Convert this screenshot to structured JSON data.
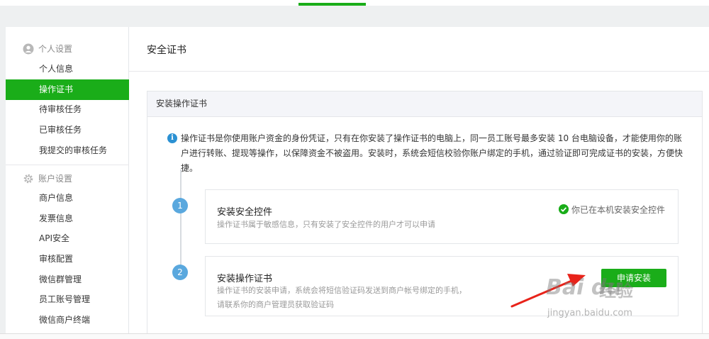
{
  "sidebar": {
    "personal_group": "个人设置",
    "personal_items": [
      "个人信息",
      "操作证书",
      "待审核任务",
      "已审核任务",
      "我提交的审核任务"
    ],
    "account_group": "账户设置",
    "account_items": [
      "商户信息",
      "发票信息",
      "API安全",
      "审核配置",
      "微信群管理",
      "员工账号管理",
      "微信商户终端"
    ],
    "active_item": "操作证书"
  },
  "main": {
    "page_title": "安全证书",
    "panel_title": "安装操作证书",
    "info_icon": "i",
    "info_text": "操作证书是你使用账户资金的身份凭证，只有在你安装了操作证书的电脑上，同一员工账号最多安装 10 台电脑设备，才能使用你的账户进行转账、提现等操作，以保障资金不被盗用。安装时，系统会短信校验你账户绑定的手机，通过验证即可完成证书的安装，方便快捷。",
    "steps": [
      {
        "number": "1",
        "title": "安装安全控件",
        "desc": "操作证书属于敏感信息，只有安装了安全控件的用户才可以申请",
        "status": "你已在本机安装安全控件"
      },
      {
        "number": "2",
        "title": "安装操作证书",
        "desc_line1": "操作证书的安装申请，系统会将短信验证码发送到商户帐号绑定的手机，",
        "desc_line2": "请联系你的商户管理员获取验证码",
        "button": "申请安装"
      }
    ]
  },
  "annotation": {
    "arrow_color": "#e8231a"
  },
  "watermark": {
    "brand": "Bai du",
    "text": "经验",
    "url": "jingyan.baidu.com"
  },
  "colors": {
    "accent": "#1aad19",
    "step": "#5aa8de",
    "info": "#2b91d3"
  }
}
